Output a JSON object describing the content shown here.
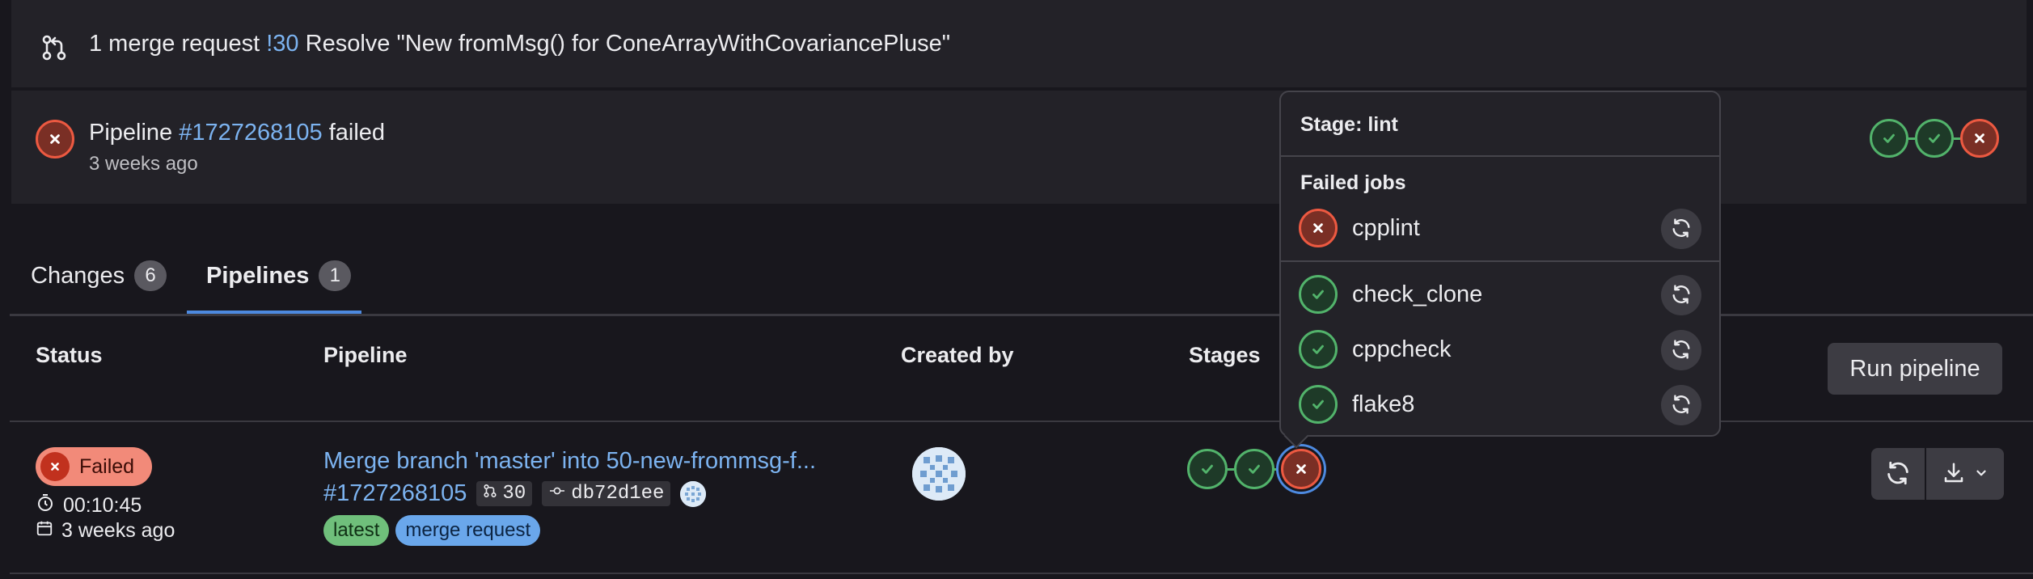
{
  "merge_request_bar": {
    "count_text": "1 merge request",
    "mr_ref": "!30",
    "mr_title": "Resolve \"New fromMsg() for ConeArrayWithCovariancePluse\""
  },
  "pipeline_bar": {
    "prefix": "Pipeline",
    "pipeline_ref": "#1727268105",
    "status_text": "failed",
    "time_ago": "3 weeks ago",
    "mini_stages": [
      "success",
      "success",
      "failed"
    ]
  },
  "tabs": [
    {
      "label": "Changes",
      "count": "6",
      "active": false
    },
    {
      "label": "Pipelines",
      "count": "1",
      "active": true
    }
  ],
  "table": {
    "headers": {
      "status": "Status",
      "pipeline": "Pipeline",
      "created_by": "Created by",
      "stages": "Stages"
    },
    "run_button": "Run pipeline",
    "row": {
      "status_badge": "Failed",
      "duration": "00:10:45",
      "finished": "3 weeks ago",
      "commit_title": "Merge branch 'master' into 50-new-frommsg-f...",
      "pipeline_id": "#1727268105",
      "mr_iid": "30",
      "commit_sha": "db72d1ee",
      "labels": [
        {
          "text": "latest",
          "color": "#6fbf7b"
        },
        {
          "text": "merge request",
          "color": "#6aa7eb"
        }
      ],
      "stages": [
        "success",
        "success",
        "failed"
      ]
    }
  },
  "popover": {
    "title": "Stage: lint",
    "failed_heading": "Failed jobs",
    "jobs": [
      {
        "name": "cpplint",
        "status": "failed"
      },
      {
        "name": "check_clone",
        "status": "success"
      },
      {
        "name": "cppcheck",
        "status": "success"
      },
      {
        "name": "flake8",
        "status": "success"
      }
    ]
  },
  "colors": {
    "background": "#18171d",
    "panel": "#232228",
    "link": "#7cb3f0",
    "success": "#52b36b",
    "failed": "#ec5941",
    "focus": "#4d8ae0"
  }
}
